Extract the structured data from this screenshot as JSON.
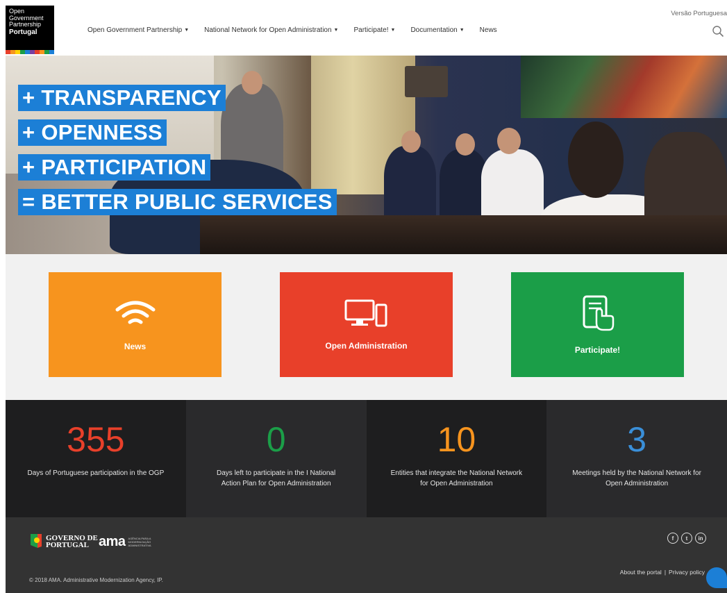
{
  "header": {
    "logo": {
      "lines": [
        "Open",
        "Government",
        "Partnership"
      ],
      "country": "Portugal"
    },
    "nav": [
      {
        "label": "Open Government Partnership",
        "has_dropdown": true
      },
      {
        "label": "National Network for Open Administration",
        "has_dropdown": true
      },
      {
        "label": "Participate!",
        "has_dropdown": true
      },
      {
        "label": "Documentation",
        "has_dropdown": true
      },
      {
        "label": "News",
        "has_dropdown": false
      }
    ],
    "language_link": "Versão Portuguesa",
    "search_icon": "search-icon"
  },
  "hero": {
    "taglines": [
      "+ TRANSPARENCY",
      "+ OPENNESS",
      "+ PARTICIPATION",
      "= BETTER PUBLIC SERVICES"
    ],
    "tag_color": "#1c7fd6"
  },
  "cards": [
    {
      "label": "News",
      "icon": "wifi-icon",
      "color": "#f7941e"
    },
    {
      "label": "Open Administration",
      "icon": "devices-icon",
      "color": "#e8402a"
    },
    {
      "label": "Participate!",
      "icon": "tablet-touch-icon",
      "color": "#1b9e48"
    }
  ],
  "stats": [
    {
      "value": "355",
      "description": "Days of Portuguese participation in the OGP",
      "color": "#e8402a",
      "bg": "#1e1e1f"
    },
    {
      "value": "0",
      "description": "Days left to participate in the I National Action Plan for Open Administration",
      "color": "#1b9e48",
      "bg": "#2a2a2c"
    },
    {
      "value": "10",
      "description": "Entities that integrate the National Network for Open Administration",
      "color": "#f7941e",
      "bg": "#1e1e1f"
    },
    {
      "value": "3",
      "description": "Meetings held by the National Network for Open Administration",
      "color": "#3a8fd9",
      "bg": "#2a2a2c"
    }
  ],
  "footer": {
    "gov_logo": [
      "GOVERNO DE",
      "PORTUGAL"
    ],
    "ama_logo": "ama",
    "ama_sub": "AGÊNCIA PARA A MODERNIZAÇÃO ADMINISTRATIVA",
    "social": [
      {
        "icon": "facebook-icon",
        "glyph": "f"
      },
      {
        "icon": "twitter-icon",
        "glyph": "t"
      },
      {
        "icon": "linkedin-icon",
        "glyph": "in"
      }
    ],
    "links": [
      "About the portal",
      "Privacy policy"
    ],
    "separator": "|",
    "copyright": "© 2018 AMA. Administrative Modernization Agency, IP."
  }
}
